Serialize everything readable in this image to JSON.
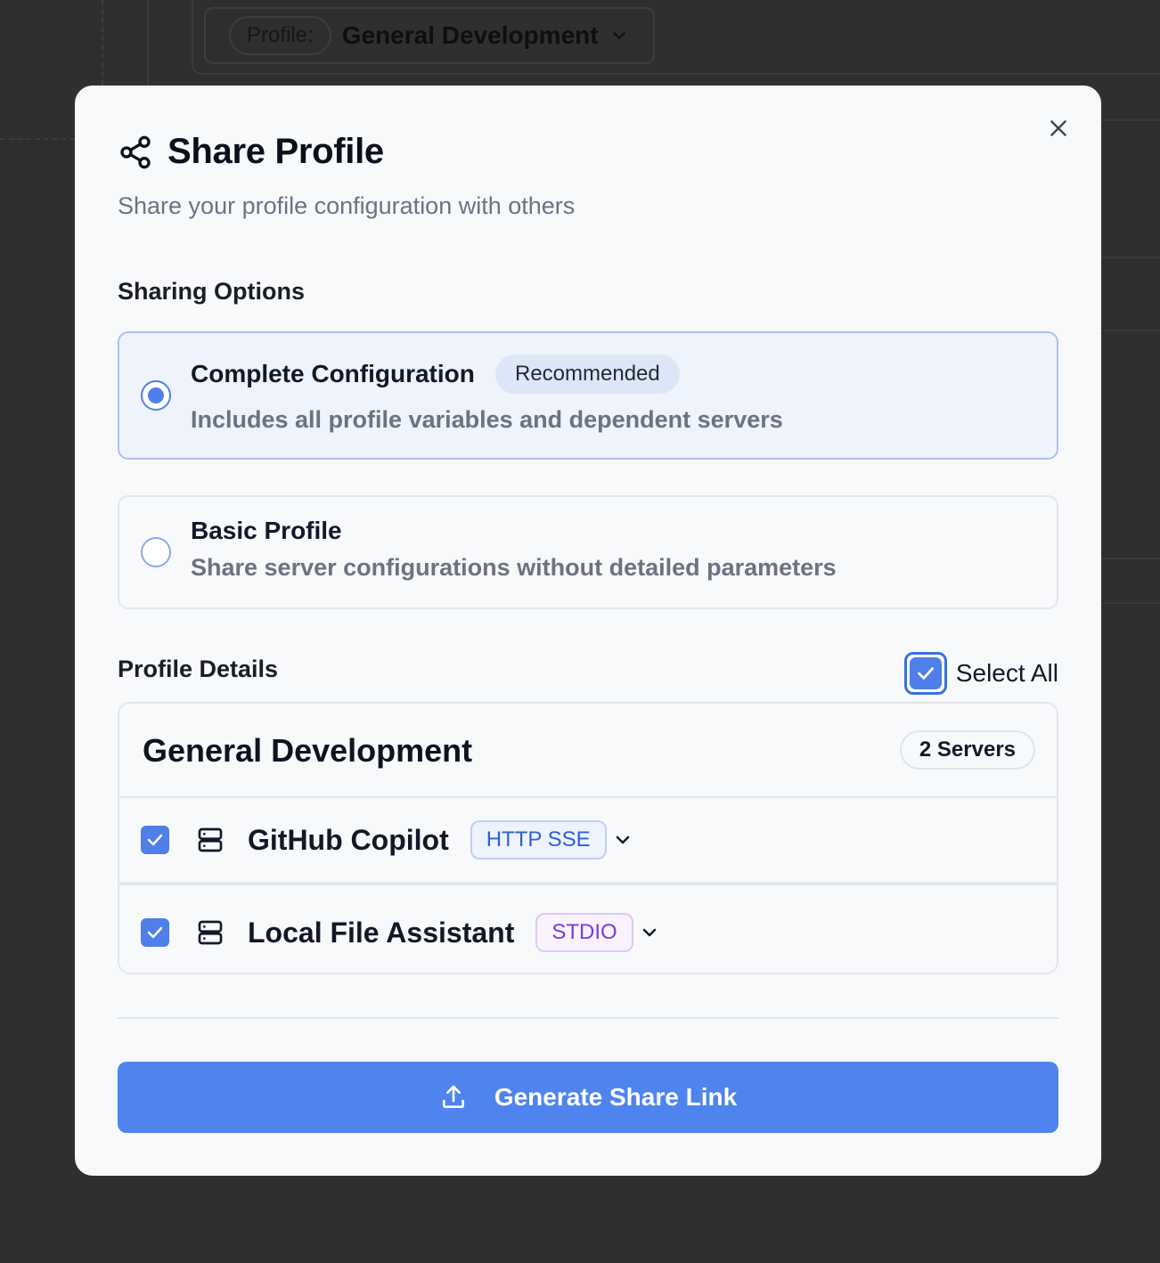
{
  "background": {
    "profile_label": "Profile:",
    "profile_value": "General Development"
  },
  "modal": {
    "title": "Share Profile",
    "subtitle": "Share your profile configuration with others",
    "sharing_options_label": "Sharing Options",
    "options": [
      {
        "title": "Complete Configuration",
        "badge": "Recommended",
        "description": "Includes all profile variables and dependent servers",
        "selected": true
      },
      {
        "title": "Basic Profile",
        "description": "Share server configurations without detailed parameters",
        "selected": false
      }
    ],
    "profile_details_label": "Profile Details",
    "select_all_label": "Select All",
    "select_all_checked": true,
    "profile": {
      "name": "General Development",
      "server_count": "2 Servers",
      "servers": [
        {
          "name": "GitHub Copilot",
          "type": "HTTP SSE",
          "checked": true
        },
        {
          "name": "Local File Assistant",
          "type": "STDIO",
          "checked": true
        }
      ]
    },
    "generate_button_label": "Generate Share Link"
  },
  "colors": {
    "accent": "#4f84ee",
    "http_tag": "#2e5fd6",
    "stdio_tag": "#7c3ad8",
    "overlay": "#2f2f2f"
  },
  "icons": [
    "share-icon",
    "close-icon",
    "server-icon",
    "chevron-down-icon",
    "check-icon",
    "upload-icon"
  ]
}
